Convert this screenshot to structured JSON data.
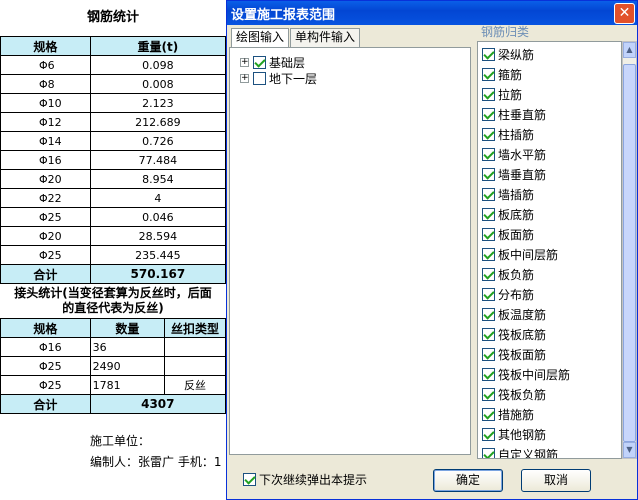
{
  "report": {
    "title": "钢筋统计",
    "headers": [
      "规格",
      "重量(t)"
    ],
    "rows": [
      {
        "spec": "Φ6",
        "weight": "0.098"
      },
      {
        "spec": "Φ8",
        "weight": "0.008"
      },
      {
        "spec": "Φ10",
        "weight": "2.123"
      },
      {
        "spec": "Φ12",
        "weight": "212.689"
      },
      {
        "spec": "Φ14",
        "weight": "0.726"
      },
      {
        "spec": "Φ16",
        "weight": "77.484"
      },
      {
        "spec": "Φ20",
        "weight": "8.954"
      },
      {
        "spec": "Φ22",
        "weight": "4"
      },
      {
        "spec": "Φ25",
        "weight": "0.046"
      },
      {
        "spec": "Φ20",
        "weight": "28.594"
      },
      {
        "spec": "Φ25",
        "weight": "235.445"
      }
    ],
    "total_label": "合计",
    "total_weight": "570.167",
    "joint_title_1": "接头统计(当变径套算为反丝时，后面",
    "joint_title_2": "的直径代表为反丝)",
    "joint_headers": [
      "规格",
      "数量",
      "丝扣类型"
    ],
    "joint_rows": [
      {
        "spec": "Φ16",
        "qty": "36",
        "type": ""
      },
      {
        "spec": "Φ25",
        "qty": "2490",
        "type": ""
      },
      {
        "spec": "Φ25",
        "qty": "1781",
        "type": "反丝"
      }
    ],
    "joint_total_label": "合计",
    "joint_total": "4307",
    "unit_label": "施工单位：",
    "maker_label": "编制人：张雷广  手机：1"
  },
  "dialog": {
    "title": "设置施工报表范围",
    "close_glyph": "✕",
    "tabs": [
      "绘图输入",
      "单构件输入"
    ],
    "tree": [
      {
        "label": "基础层",
        "checked": true
      },
      {
        "label": "地下一层",
        "checked": false
      }
    ],
    "category_header": "钢筋归类",
    "categories": [
      "梁纵筋",
      "箍筋",
      "拉筋",
      "柱垂直筋",
      "柱插筋",
      "墙水平筋",
      "墙垂直筋",
      "墙插筋",
      "板底筋",
      "板面筋",
      "板中间层筋",
      "板负筋",
      "分布筋",
      "板温度筋",
      "筏板底筋",
      "筏板面筋",
      "筏板中间层筋",
      "筏板负筋",
      "措施筋",
      "其他钢筋",
      "自定义钢筋"
    ],
    "next_prompt": "下次继续弹出本提示",
    "next_prompt_checked": true,
    "ok_label": "确定",
    "cancel_label": "取消",
    "scroll_up": "▲",
    "scroll_down": "▼",
    "check_color": "#21a121",
    "title_bar_color": "#0346d3"
  }
}
